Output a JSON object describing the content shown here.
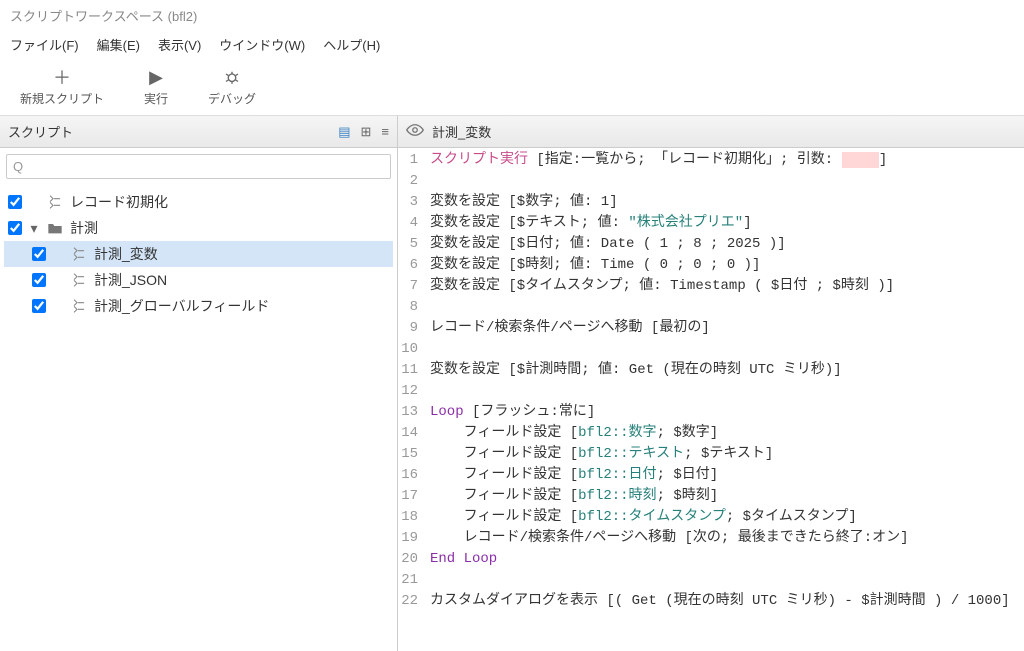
{
  "window": {
    "title": "スクリプトワークスペース (bfl2)"
  },
  "menu": {
    "file": "ファイル(F)",
    "edit": "編集(E)",
    "view": "表示(V)",
    "window": "ウインドウ(W)",
    "help": "ヘルプ(H)"
  },
  "toolbar": {
    "new": "新規スクリプト",
    "run": "実行",
    "debug": "デバッグ"
  },
  "sidebar": {
    "header": "スクリプト",
    "search_placeholder": "",
    "items": [
      {
        "label": "レコード初期化"
      },
      {
        "label": "計測"
      },
      {
        "label": "計測_変数"
      },
      {
        "label": "計測_JSON"
      },
      {
        "label": "計測_グローバルフィールド"
      }
    ]
  },
  "editor": {
    "title": "計測_変数",
    "code": {
      "l1a": "スクリプト実行",
      "l1b": " [指定:一覧から; 「レコード初期化」; 引数: ",
      "l1c": "   ",
      "l1d": "]",
      "l3": "変数を設定 [$数字; 値: 1]",
      "l4a": "変数を設定 [$テキスト; 値: ",
      "l4b": "\"株式会社プリエ\"",
      "l4c": "]",
      "l5": "変数を設定 [$日付; 値: Date ( 1 ; 8 ; 2025 )]",
      "l6": "変数を設定 [$時刻; 値: Time ( 0 ; 0 ; 0 )]",
      "l7": "変数を設定 [$タイムスタンプ; 値: Timestamp ( $日付 ; $時刻 )]",
      "l9": "レコード/検索条件/ページへ移動 [最初の]",
      "l11": "変数を設定 [$計測時間; 値: Get (現在の時刻 UTC ミリ秒)]",
      "l13a": "Loop",
      "l13b": " [フラッシュ:常に]",
      "l14a": "    フィールド設定 [",
      "l14b": "bfl2::数字",
      "l14c": "; $数字]",
      "l15a": "    フィールド設定 [",
      "l15b": "bfl2::テキスト",
      "l15c": "; $テキスト]",
      "l16a": "    フィールド設定 [",
      "l16b": "bfl2::日付",
      "l16c": "; $日付]",
      "l17a": "    フィールド設定 [",
      "l17b": "bfl2::時刻",
      "l17c": "; $時刻]",
      "l18a": "    フィールド設定 [",
      "l18b": "bfl2::タイムスタンプ",
      "l18c": "; $タイムスタンプ]",
      "l19": "    レコード/検索条件/ページへ移動 [次の; 最後まできたら終了:オン]",
      "l20": "End Loop",
      "l22": "カスタムダイアログを表示 [( Get (現在の時刻 UTC ミリ秒) - $計測時間 ) / 1000]"
    }
  }
}
